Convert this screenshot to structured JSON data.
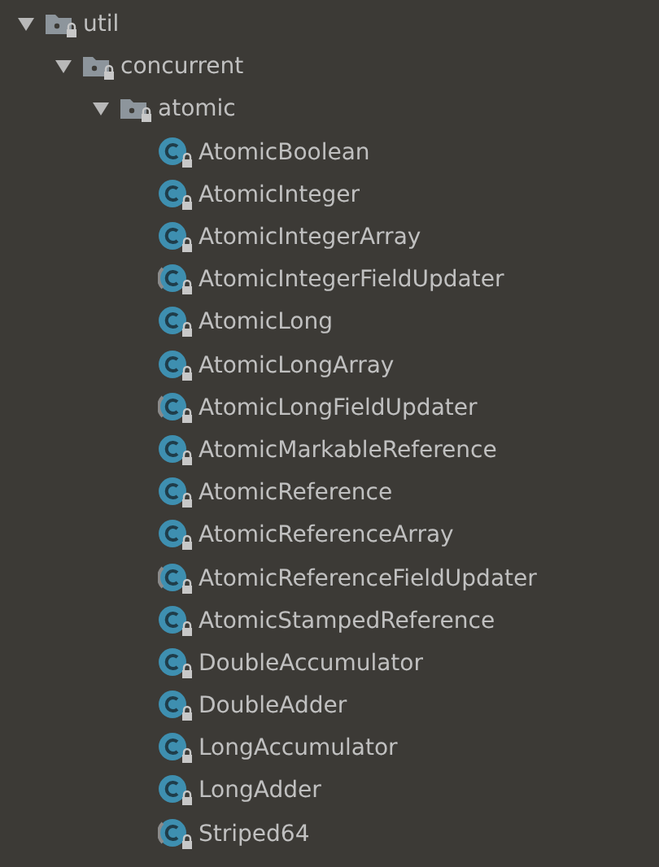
{
  "tree": [
    {
      "label": "util",
      "kind": "package",
      "expanded": true,
      "children": [
        {
          "label": "concurrent",
          "kind": "package",
          "expanded": true,
          "children": [
            {
              "label": "atomic",
              "kind": "package",
              "expanded": true,
              "children": [
                {
                  "label": "AtomicBoolean",
                  "kind": "class"
                },
                {
                  "label": "AtomicInteger",
                  "kind": "class"
                },
                {
                  "label": "AtomicIntegerArray",
                  "kind": "class"
                },
                {
                  "label": "AtomicIntegerFieldUpdater",
                  "kind": "abstract_class"
                },
                {
                  "label": "AtomicLong",
                  "kind": "class"
                },
                {
                  "label": "AtomicLongArray",
                  "kind": "class"
                },
                {
                  "label": "AtomicLongFieldUpdater",
                  "kind": "abstract_class"
                },
                {
                  "label": "AtomicMarkableReference",
                  "kind": "class"
                },
                {
                  "label": "AtomicReference",
                  "kind": "class"
                },
                {
                  "label": "AtomicReferenceArray",
                  "kind": "class"
                },
                {
                  "label": "AtomicReferenceFieldUpdater",
                  "kind": "abstract_class"
                },
                {
                  "label": "AtomicStampedReference",
                  "kind": "class"
                },
                {
                  "label": "DoubleAccumulator",
                  "kind": "class"
                },
                {
                  "label": "DoubleAdder",
                  "kind": "class"
                },
                {
                  "label": "LongAccumulator",
                  "kind": "class"
                },
                {
                  "label": "LongAdder",
                  "kind": "class"
                },
                {
                  "label": "Striped64",
                  "kind": "abstract_class"
                }
              ]
            }
          ]
        }
      ]
    }
  ]
}
